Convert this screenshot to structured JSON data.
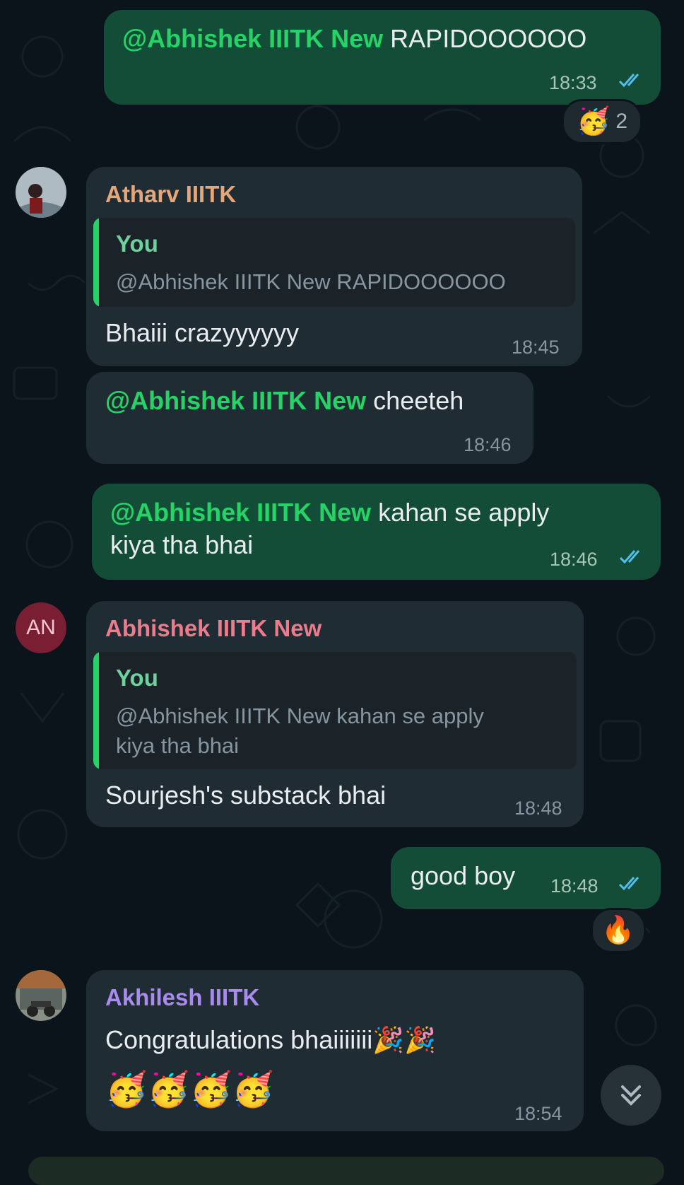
{
  "messages": {
    "m1": {
      "mention": "@Abhishek IIITK New",
      "text": " RAPIDOOOOOO",
      "time": "18:33"
    },
    "m1_reaction": {
      "emoji": "🥳",
      "count": "2"
    },
    "m2": {
      "sender": "Atharv IIITK",
      "quote_author": "You",
      "quote_text": "@Abhishek IIITK New RAPIDOOOOOO",
      "text": "Bhaiii crazyyyyyy",
      "time": "18:45"
    },
    "m3": {
      "mention": "@Abhishek IIITK New",
      "text": " cheeteh",
      "time": "18:46"
    },
    "m4": {
      "mention": "@Abhishek IIITK New",
      "text_line1": " kahan se apply",
      "text_line2": "kiya tha bhai",
      "time": "18:46"
    },
    "m5": {
      "sender": "Abhishek IIITK New",
      "avatar_initials": "AN",
      "quote_author": "You",
      "quote_line1": "@Abhishek IIITK New kahan se apply",
      "quote_line2": "kiya tha bhai",
      "text": "Sourjesh's substack bhai",
      "time": "18:48"
    },
    "m6": {
      "text": "good boy",
      "time": "18:48"
    },
    "m6_reaction": {
      "emoji": "🔥"
    },
    "m7": {
      "sender": "Akhilesh IIITK",
      "text_line1": "Congratulations bhaiiiiiii🎉🎉",
      "text_line2": "🥳🥳🥳🥳",
      "time": "18:54"
    }
  },
  "colors": {
    "background": "#0b141a",
    "outgoing_bubble": "#144d37",
    "incoming_bubble": "#202c33",
    "mention": "#25d366",
    "sender_atharv": "#e5a679",
    "sender_abhishek": "#ee7b8c",
    "sender_akhilesh": "#a98bf0",
    "read_ticks": "#53bdeb"
  },
  "icons": {
    "read_receipt": "double-check-icon",
    "scroll_down": "double-chevron-down-icon"
  }
}
